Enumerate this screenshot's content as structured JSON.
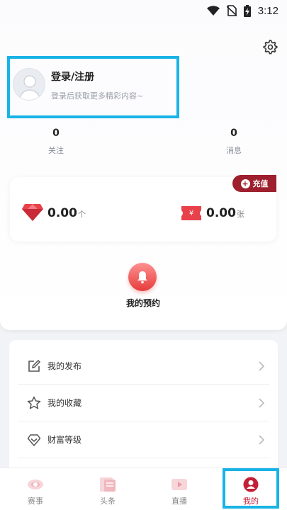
{
  "status_bar": {
    "time": "3:12"
  },
  "profile": {
    "title": "登录/注册",
    "subtitle": "登录后获取更多精彩内容~"
  },
  "stats": [
    {
      "value": "0",
      "label": "关注"
    },
    {
      "value": "0",
      "label": "消息"
    }
  ],
  "wallet": {
    "recharge_label": "充值",
    "diamonds": {
      "value": "0.00",
      "unit": "个"
    },
    "tickets": {
      "value": "0.00",
      "unit": "张"
    }
  },
  "reservation": {
    "label": "我的预约"
  },
  "menu": [
    {
      "label": "我的发布",
      "icon": "edit-icon"
    },
    {
      "label": "我的收藏",
      "icon": "star-icon"
    },
    {
      "label": "财富等级",
      "icon": "wealth-level-icon"
    }
  ],
  "bottom_nav": [
    {
      "label": "赛事",
      "icon": "events-icon"
    },
    {
      "label": "头条",
      "icon": "headlines-icon"
    },
    {
      "label": "直播",
      "icon": "live-icon"
    },
    {
      "label": "我的",
      "icon": "profile-icon",
      "active": true
    }
  ],
  "colors": {
    "accent": "#c41f36",
    "recharge_bg": "#9e1f2d",
    "highlight_box": "#19b3e6"
  }
}
